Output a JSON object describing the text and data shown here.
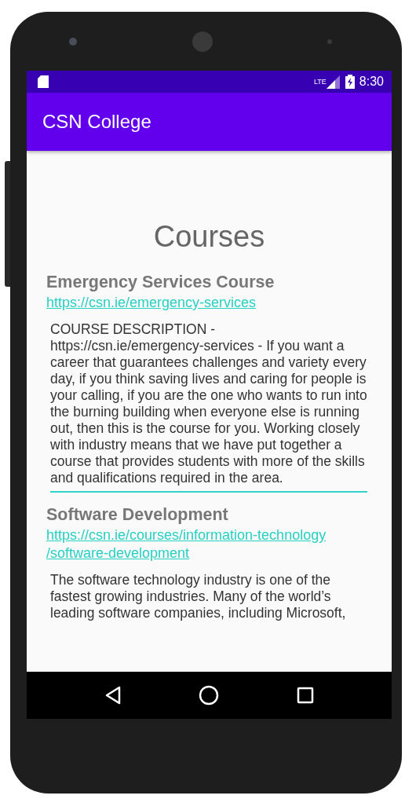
{
  "status_bar": {
    "time": "8:30",
    "network": "LTE"
  },
  "app_bar": {
    "title": "CSN College"
  },
  "page_title": "Courses",
  "courses": [
    {
      "name": "Emergency Services Course",
      "url_lines": [
        "https://csn.ie/emergency-services"
      ],
      "description": "COURSE DESCRIPTION - https://csn.ie/emergency-services - If you want a career that guarantees challenges and variety every day, if you think saving lives and caring for people is your calling, if you are the one who wants to run into the burning building when everyone else is running out, then this is the course for you.  Working closely with industry means that we have put together a course that provides students with more of the skills and qualifications required in the area.",
      "focused": true
    },
    {
      "name": "Software Development",
      "url_lines": [
        "https://csn.ie/courses/information-technology",
        "/software-development"
      ],
      "description": "The software technology industry is one of the fastest growing industries. Many of the world’s leading software companies, including Microsoft,",
      "focused": false
    }
  ]
}
